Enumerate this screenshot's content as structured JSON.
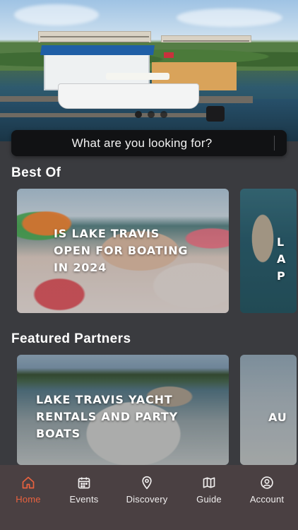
{
  "search": {
    "placeholder": "What are you looking for?"
  },
  "hero": {
    "carousel_total": 3,
    "carousel_active": 1
  },
  "sections": {
    "best_of": {
      "title": "Best Of",
      "cards": [
        {
          "title": "IS LAKE TRAVIS OPEN FOR BOATING IN 2024"
        },
        {
          "title": "LA P"
        }
      ]
    },
    "featured": {
      "title": "Featured Partners",
      "cards": [
        {
          "title": "LAKE TRAVIS YACHT RENTALS AND PARTY BOATS"
        },
        {
          "title": "AU"
        }
      ]
    }
  },
  "tabbar": {
    "active_color": "#e9623f",
    "items": [
      {
        "label": "Home",
        "icon": "home-icon"
      },
      {
        "label": "Events",
        "icon": "calendar-icon"
      },
      {
        "label": "Discovery",
        "icon": "map-pin-icon"
      },
      {
        "label": "Guide",
        "icon": "map-icon"
      },
      {
        "label": "Account",
        "icon": "account-icon"
      }
    ]
  }
}
